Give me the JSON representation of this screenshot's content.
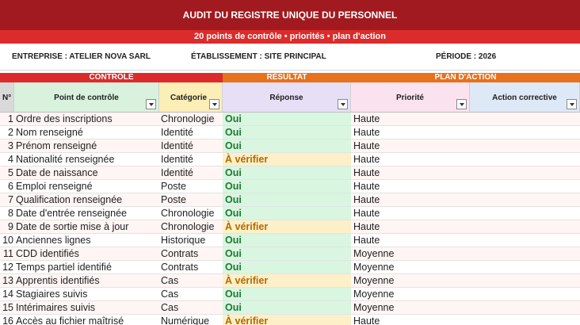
{
  "header": {
    "title": "AUDIT DU REGISTRE UNIQUE DU PERSONNEL",
    "subtitle": "20 points de contrôle • priorités • plan d'action"
  },
  "info": {
    "entreprise": "ENTREPRISE : ATELIER NOVA SARL",
    "etablissement": "ÉTABLISSEMENT : SITE PRINCIPAL",
    "periode": "PÉRIODE : 2026"
  },
  "sections": {
    "controle": "CONTRÔLE",
    "resultat": "RÉSULTAT",
    "plan": "PLAN D'ACTION"
  },
  "columns": {
    "num": "N°",
    "point": "Point de contrôle",
    "categorie": "Catégorie",
    "reponse": "Réponse",
    "priorite": "Priorité",
    "action": "Action corrective"
  },
  "colors": {
    "title_bg": "#a11a1f",
    "subtitle_bg": "#dc2b2b",
    "ok_text": "#1e7a31",
    "check_text": "#b26a00"
  },
  "rows": [
    {
      "num": "1",
      "point": "Ordre des inscriptions",
      "categorie": "Chronologie",
      "reponse": "Oui",
      "priorite": "Haute",
      "action": ""
    },
    {
      "num": "2",
      "point": "Nom renseigné",
      "categorie": "Identité",
      "reponse": "Oui",
      "priorite": "Haute",
      "action": ""
    },
    {
      "num": "3",
      "point": "Prénom renseigné",
      "categorie": "Identité",
      "reponse": "Oui",
      "priorite": "Haute",
      "action": ""
    },
    {
      "num": "4",
      "point": "Nationalité renseignée",
      "categorie": "Identité",
      "reponse": "À vérifier",
      "priorite": "Haute",
      "action": ""
    },
    {
      "num": "5",
      "point": "Date de naissance",
      "categorie": "Identité",
      "reponse": "Oui",
      "priorite": "Haute",
      "action": ""
    },
    {
      "num": "6",
      "point": "Emploi renseigné",
      "categorie": "Poste",
      "reponse": "Oui",
      "priorite": "Haute",
      "action": ""
    },
    {
      "num": "7",
      "point": "Qualification renseignée",
      "categorie": "Poste",
      "reponse": "Oui",
      "priorite": "Haute",
      "action": ""
    },
    {
      "num": "8",
      "point": "Date d'entrée renseignée",
      "categorie": "Chronologie",
      "reponse": "Oui",
      "priorite": "Haute",
      "action": ""
    },
    {
      "num": "9",
      "point": "Date de sortie mise à jour",
      "categorie": "Chronologie",
      "reponse": "À vérifier",
      "priorite": "Haute",
      "action": ""
    },
    {
      "num": "10",
      "point": "Anciennes lignes",
      "categorie": "Historique",
      "reponse": "Oui",
      "priorite": "Haute",
      "action": ""
    },
    {
      "num": "11",
      "point": "CDD identifiés",
      "categorie": "Contrats",
      "reponse": "Oui",
      "priorite": "Moyenne",
      "action": ""
    },
    {
      "num": "12",
      "point": "Temps partiel identifié",
      "categorie": "Contrats",
      "reponse": "Oui",
      "priorite": "Moyenne",
      "action": ""
    },
    {
      "num": "13",
      "point": "Apprentis identifiés",
      "categorie": "Cas",
      "reponse": "À vérifier",
      "priorite": "Moyenne",
      "action": ""
    },
    {
      "num": "14",
      "point": "Stagiaires suivis",
      "categorie": "Cas",
      "reponse": "Oui",
      "priorite": "Moyenne",
      "action": ""
    },
    {
      "num": "15",
      "point": "Intérimaires suivis",
      "categorie": "Cas",
      "reponse": "Oui",
      "priorite": "Moyenne",
      "action": ""
    },
    {
      "num": "16",
      "point": "Accès au fichier maîtrisé",
      "categorie": "Numérique",
      "reponse": "À vérifier",
      "priorite": "Haute",
      "action": ""
    }
  ]
}
